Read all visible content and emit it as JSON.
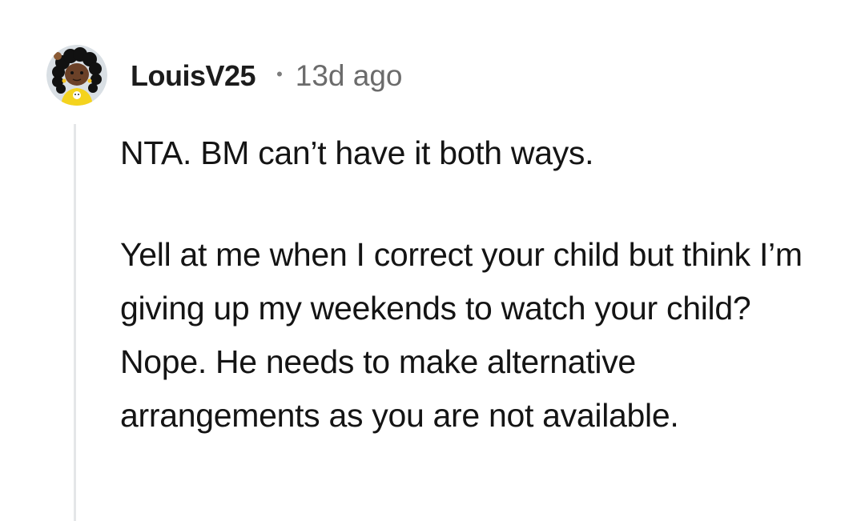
{
  "comment": {
    "author": {
      "username": "LouisV25",
      "avatar_icon": "avatar-icon"
    },
    "separator": "•",
    "timestamp": "13d ago",
    "body": {
      "paragraphs": [
        "NTA. BM can’t have it both ways.",
        "Yell at me when I correct your child but think I’m giving up my weekends to watch your child? Nope. He needs to make alternative arrangements as you are not available."
      ]
    }
  },
  "colors": {
    "background": "#ffffff",
    "text": "#141414",
    "meta_text": "#6b6b6b",
    "thread_line": "#e4e6e8"
  }
}
